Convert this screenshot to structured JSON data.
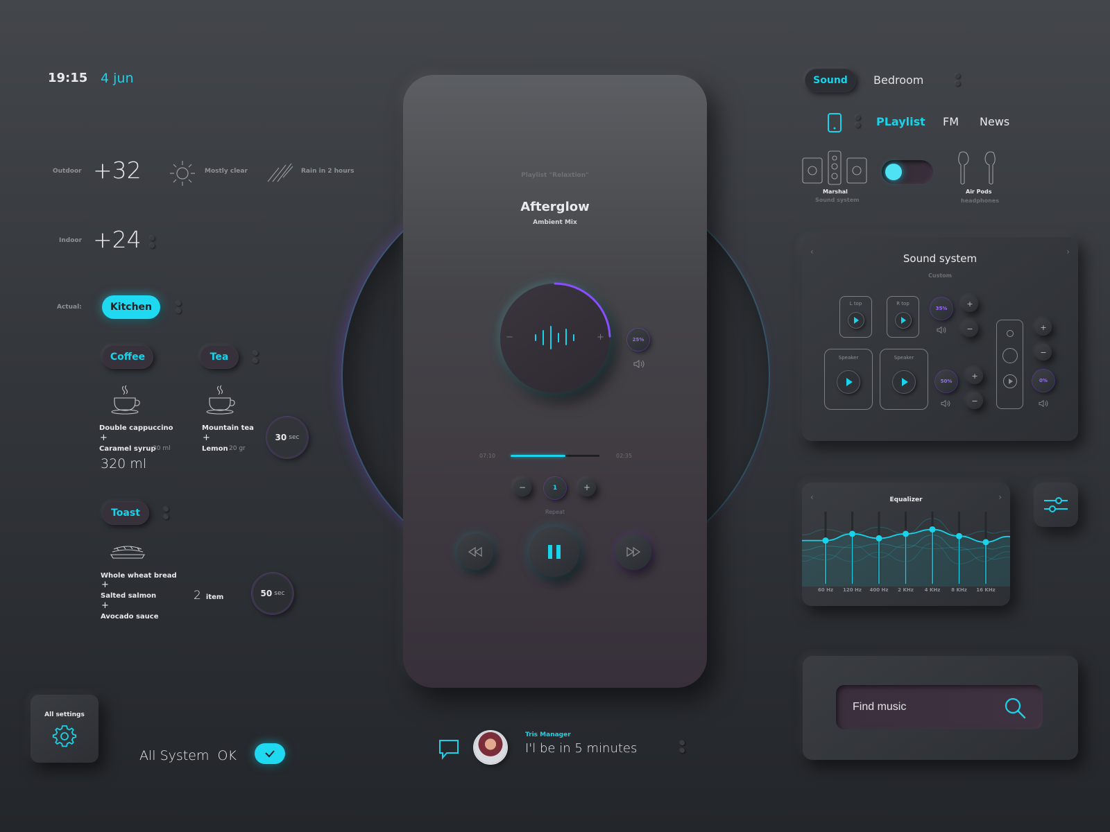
{
  "header": {
    "time": "19:15",
    "date": "4 jun"
  },
  "weather": {
    "outdoor_label": "Outdoor",
    "outdoor_temp": "+32",
    "condition": "Mostly clear",
    "rain": "Rain in 2 hours",
    "indoor_label": "Indoor",
    "indoor_temp": "+24"
  },
  "room": {
    "actual_label": "Actual:",
    "selected": "Kitchen"
  },
  "kitchen": {
    "coffee": {
      "label": "Coffee",
      "item1": "Double cappuccino",
      "plus1": "+",
      "item2": "Caramel syrup",
      "item2_qty": "30 ml",
      "total": "320 ml"
    },
    "tea": {
      "label": "Tea",
      "item1": "Mountain tea",
      "plus1": "+",
      "item2": "Lemon",
      "item2_qty": "20 gr",
      "timer_value": "30",
      "timer_unit": "sec"
    },
    "toast": {
      "label": "Toast",
      "item1": "Whole wheat bread",
      "plus1": "+",
      "item2": "Salted salmon",
      "plus2": "+",
      "item3": "Avocado sauce",
      "count": "2",
      "count_unit": "item",
      "timer_value": "50",
      "timer_unit": "sec"
    }
  },
  "settings": {
    "label": "All settings",
    "status": "All System  OK"
  },
  "player": {
    "playlist": "Playlist \"Relaxtion\"",
    "title": "Afterglow",
    "subtitle": "Ambient Mix",
    "minus": "−",
    "plus": "+",
    "volume": "25%",
    "volume_level": 0.25,
    "time_elapsed": "07:10",
    "time_total": "02:35",
    "progress": 0.62,
    "repeat_value": "1",
    "repeat_label": "Repeat"
  },
  "message": {
    "sender": "Tris Manager",
    "text": "I'l be in 5 minutes"
  },
  "audio": {
    "tabs": [
      "Sound",
      "Bedroom"
    ],
    "sources": [
      "PLaylist",
      "FM",
      "News"
    ],
    "device1": "Marshal",
    "device1_sub": "Sound system",
    "device2": "Air Pods",
    "device2_sub": "headphones",
    "toggle_on": true
  },
  "sound_system": {
    "title": "Sound system",
    "subtitle": "Custom",
    "ltop": "L top",
    "rtop": "R top",
    "speaker1": "Speaker",
    "speaker2": "Speaker",
    "vol1": "35%",
    "vol2": "50%",
    "vol3": "0%"
  },
  "equalizer": {
    "title": "Equalizer",
    "bands": [
      "60 Hz",
      "120 Hz",
      "400 Hz",
      "2 KHz",
      "4 KHz",
      "8 KHz",
      "16 KHz"
    ],
    "levels": [
      0.42,
      0.3,
      0.38,
      0.3,
      0.22,
      0.34,
      0.45
    ]
  },
  "search": {
    "placeholder": "Find music"
  },
  "colors": {
    "accent": "#19d3ea",
    "purple": "#8a4dff",
    "background": "#35383d"
  },
  "icons": [
    "sun-icon",
    "rain-icon",
    "coffee-cup-icon",
    "tea-cup-icon",
    "toast-icon",
    "gear-icon",
    "check-icon",
    "chat-icon",
    "phone-icon",
    "speaker-icon",
    "airpods-icon",
    "search-icon",
    "sliders-icon",
    "rewind-icon",
    "pause-icon",
    "forward-icon"
  ]
}
